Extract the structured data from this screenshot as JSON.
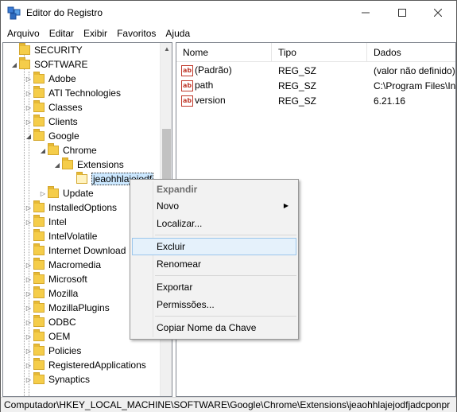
{
  "window": {
    "title": "Editor do Registro",
    "controls": {
      "minimize": "—",
      "maximize": "☐",
      "close": "✕"
    }
  },
  "menubar": [
    "Arquivo",
    "Editar",
    "Exibir",
    "Favoritos",
    "Ajuda"
  ],
  "tree": {
    "items": [
      {
        "label": "SECURITY"
      },
      {
        "label": "SOFTWARE"
      },
      {
        "label": "Adobe"
      },
      {
        "label": "ATI Technologies"
      },
      {
        "label": "Classes"
      },
      {
        "label": "Clients"
      },
      {
        "label": "Google"
      },
      {
        "label": "Chrome"
      },
      {
        "label": "Extensions"
      },
      {
        "label": "jeaohhlajejodf"
      },
      {
        "label": "Update"
      },
      {
        "label": "InstalledOptions"
      },
      {
        "label": "Intel"
      },
      {
        "label": "IntelVolatile"
      },
      {
        "label": "Internet Download"
      },
      {
        "label": "Macromedia"
      },
      {
        "label": "Microsoft"
      },
      {
        "label": "Mozilla"
      },
      {
        "label": "MozillaPlugins"
      },
      {
        "label": "ODBC"
      },
      {
        "label": "OEM"
      },
      {
        "label": "Policies"
      },
      {
        "label": "RegisteredApplications"
      },
      {
        "label": "Synaptics"
      }
    ]
  },
  "list": {
    "columns": [
      "Nome",
      "Tipo",
      "Dados"
    ],
    "rows": [
      {
        "name": "(Padrão)",
        "type": "REG_SZ",
        "data": "(valor não definido)"
      },
      {
        "name": "path",
        "type": "REG_SZ",
        "data": "C:\\Program Files\\In"
      },
      {
        "name": "version",
        "type": "REG_SZ",
        "data": "6.21.16"
      }
    ],
    "icon_text": "ab"
  },
  "context_menu": {
    "items": {
      "expand": "Expandir",
      "new": "Novo",
      "find": "Localizar...",
      "delete": "Excluir",
      "rename": "Renomear",
      "export": "Exportar",
      "permissions": "Permissões...",
      "copy_key_name": "Copiar Nome da Chave"
    },
    "submenu_arrow": "▶"
  },
  "statusbar": {
    "path": "Computador\\HKEY_LOCAL_MACHINE\\SOFTWARE\\Google\\Chrome\\Extensions\\jeaohhlajejodfjadcponpr"
  },
  "colors": {
    "selection": "#cce8ff",
    "folder": "#f5cd4a",
    "menu_highlight": "#e5f1fb"
  }
}
